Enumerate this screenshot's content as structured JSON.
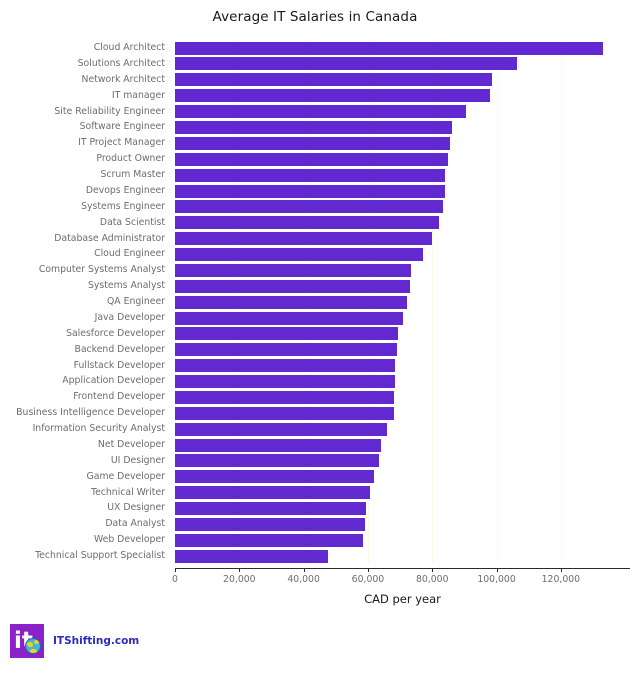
{
  "chart_data": {
    "type": "bar",
    "orientation": "horizontal",
    "title": "Average IT Salaries in Canada",
    "xlabel": "CAD per year",
    "ylabel": "",
    "xlim": [
      0,
      141500
    ],
    "xticks": [
      0,
      20000,
      40000,
      60000,
      80000,
      100000,
      120000
    ],
    "xtick_labels": [
      "0",
      "20,000",
      "40,000",
      "60,000",
      "80,000",
      "100,000",
      "120,000"
    ],
    "grid": "vertical",
    "legend": "none",
    "bar_color": "#6229d1",
    "gridline_color": "#fdf8e3",
    "categories": [
      "Cloud Architect",
      "Solutions Architect",
      "Network Architect",
      "IT manager",
      "Site Reliability Engineer",
      "Software Engineer",
      "IT Project Manager",
      "Product Owner",
      "Scrum Master",
      "Devops Engineer",
      "Systems Engineer",
      "Data Scientist",
      "Database Administrator",
      "Cloud Engineer",
      "Computer Systems Analyst",
      "Systems Analyst",
      "QA Engineer",
      "Java Developer",
      "Salesforce Developer",
      "Backend Developer",
      "Fullstack Developer",
      "Application Developer",
      "Frontend Developer",
      "Business Intelligence Developer",
      "Information Security Analyst",
      "Net Developer",
      "UI Designer",
      "Game Developer",
      "Technical Writer",
      "UX Designer",
      "Data Analyst",
      "Web Developer",
      "Technical Support Specialist"
    ],
    "values": [
      133000,
      106500,
      98500,
      98000,
      90500,
      86000,
      85500,
      85000,
      84000,
      84000,
      83500,
      82000,
      80000,
      77000,
      73500,
      73000,
      72000,
      71000,
      69500,
      69000,
      68500,
      68500,
      68000,
      68000,
      66000,
      64000,
      63500,
      62000,
      60500,
      59500,
      59000,
      58500,
      47500
    ]
  },
  "watermark": {
    "logo_text": "ITShifting.com",
    "logo_mark_text": "it"
  }
}
